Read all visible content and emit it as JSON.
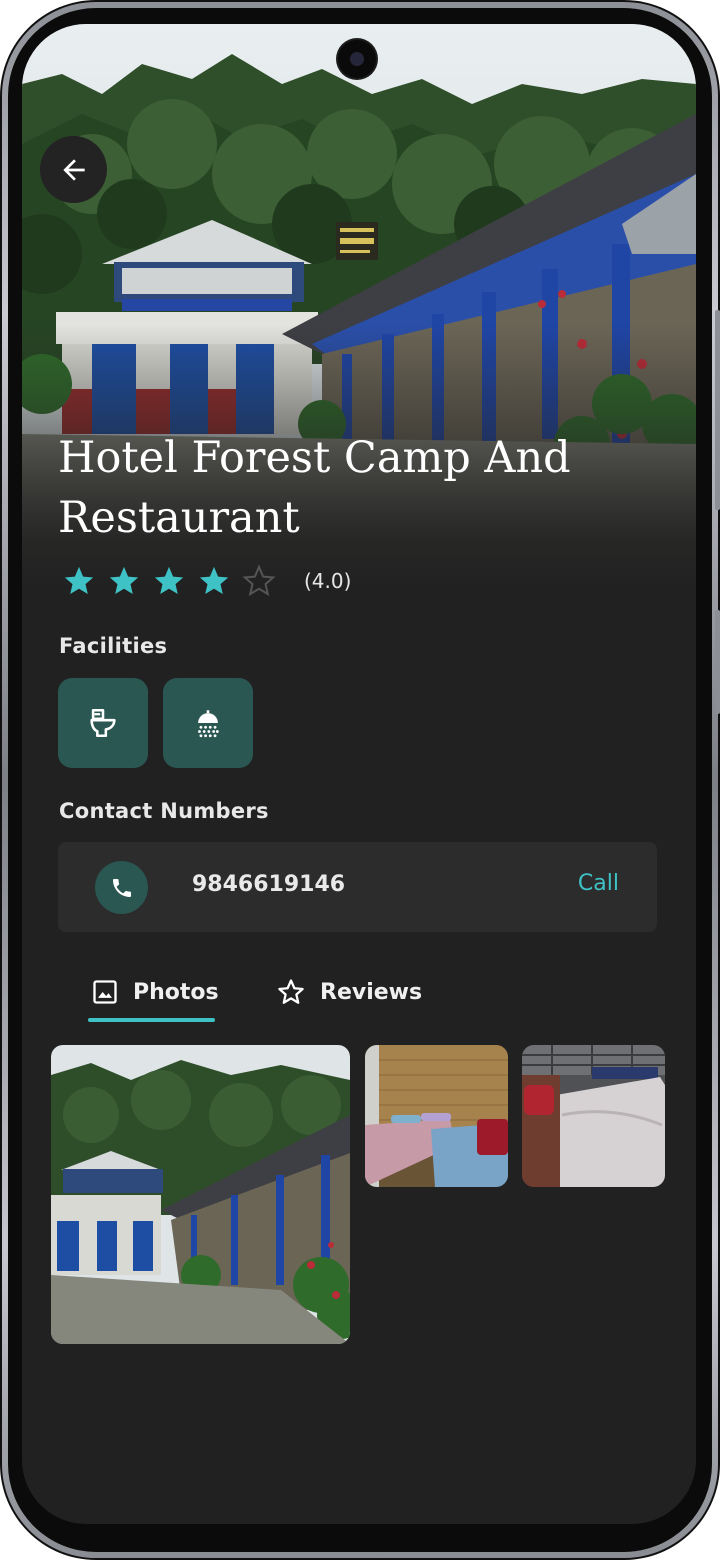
{
  "hotel": {
    "name": "Hotel Forest Camp And Restaurant",
    "rating": 4.0,
    "rating_text": "(4.0)",
    "max_rating": 5
  },
  "facilities": {
    "label": "Facilities",
    "items": [
      {
        "icon": "toilet-icon"
      },
      {
        "icon": "shower-icon"
      }
    ]
  },
  "contact": {
    "label": "Contact Numbers",
    "number": "9846619146",
    "call_label": "Call"
  },
  "tabs": [
    {
      "label": "Photos",
      "icon": "image-icon",
      "active": true
    },
    {
      "label": "Reviews",
      "icon": "star-outline-icon",
      "active": false
    }
  ],
  "colors": {
    "accent": "#3fc2c6",
    "facility_bg": "#2a5752",
    "background": "#212121",
    "card": "#2c2c2c"
  }
}
